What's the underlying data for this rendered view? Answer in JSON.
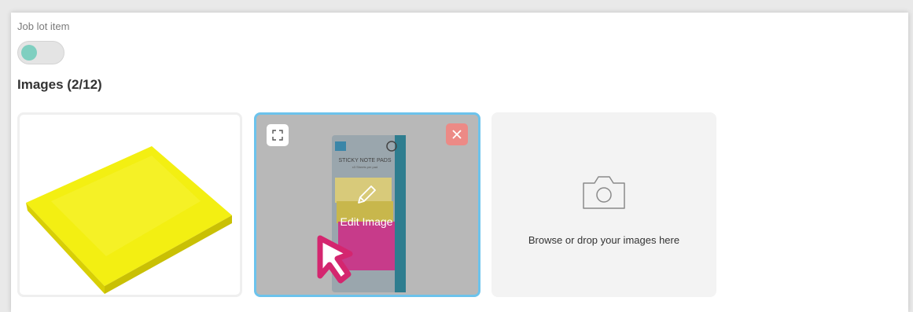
{
  "job_lot": {
    "label": "Job lot item",
    "toggle_on": true,
    "knob_color": "#7fcfc0"
  },
  "images": {
    "title": "Images (2/12)",
    "items": [
      {
        "name": "yellow-sticky-note-pad"
      },
      {
        "name": "sticky-note-pads-package",
        "package_text": "STICKY NOTE PADS",
        "package_subtext": "x3 Sheets per pad",
        "selected": true
      }
    ],
    "edit_label": "Edit Image",
    "upload": {
      "icon": "camera-icon",
      "text": "Browse or drop your images here"
    }
  },
  "colors": {
    "selected_border": "#6cc3ec",
    "remove_button": "#ec8a86",
    "cursor_outline": "#d4266f"
  }
}
